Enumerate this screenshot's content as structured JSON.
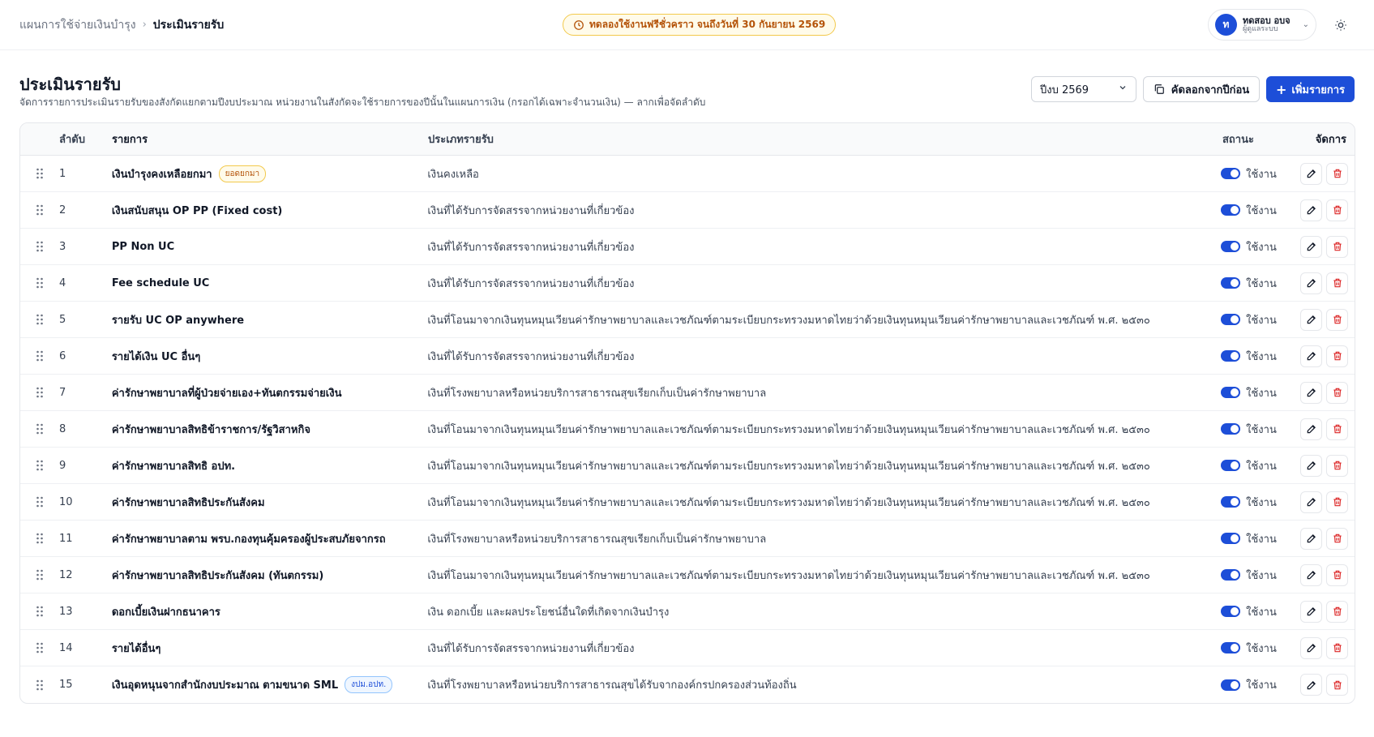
{
  "breadcrumb": {
    "parent": "แผนการใช้จ่ายเงินบำรุง",
    "current": "ประเมินรายรับ"
  },
  "trial": {
    "text": "ทดลองใช้งานฟรีชั่วคราว จนถึงวันที่ 30 กันยายน 2569"
  },
  "user": {
    "initial": "ท",
    "name": "ทดสอบ อบจ",
    "role": "ผู้ดูแลระบบ"
  },
  "page": {
    "title": "ประเมินรายรับ",
    "subtitle": "จัดการรายการประเมินรายรับของสังกัดแยกตามปีงบประมาณ หน่วยงานในสังกัดจะใช้รายการของปีนั้นในแผนการเงิน (กรอกได้เฉพาะจำนวนเงิน) — ลากเพื่อจัดลำดับ"
  },
  "toolbar": {
    "year_value": "ปีงบ 2569",
    "copy_label": "คัดลอกจากปีก่อน",
    "add_label": "เพิ่มรายการ"
  },
  "table": {
    "headers": {
      "order": "ลำดับ",
      "name": "รายการ",
      "type": "ประเภทรายรับ",
      "status": "สถานะ",
      "actions": "จัดการ"
    },
    "rows": [
      {
        "order": "1",
        "name": "เงินบำรุงคงเหลือยกมา",
        "tag": "ยอดยกมา",
        "tag_style": "amber",
        "type": "เงินคงเหลือ",
        "status": "ใช้งาน"
      },
      {
        "order": "2",
        "name": "เงินสนับสนุน OP PP (Fixed cost)",
        "tag": "",
        "tag_style": "",
        "type": "เงินที่ได้รับการจัดสรรจากหน่วยงานที่เกี่ยวข้อง",
        "status": "ใช้งาน"
      },
      {
        "order": "3",
        "name": "PP Non UC",
        "tag": "",
        "tag_style": "",
        "type": "เงินที่ได้รับการจัดสรรจากหน่วยงานที่เกี่ยวข้อง",
        "status": "ใช้งาน"
      },
      {
        "order": "4",
        "name": "Fee schedule UC",
        "tag": "",
        "tag_style": "",
        "type": "เงินที่ได้รับการจัดสรรจากหน่วยงานที่เกี่ยวข้อง",
        "status": "ใช้งาน"
      },
      {
        "order": "5",
        "name": "รายรับ UC OP anywhere",
        "tag": "",
        "tag_style": "",
        "type": "เงินที่โอนมาจากเงินทุนหมุนเวียนค่ารักษาพยาบาลและเวชภัณฑ์ตามระเบียบกระทรวงมหาดไทยว่าด้วยเงินทุนหมุนเวียนค่ารักษาพยาบาลและเวชภัณฑ์ พ.ศ. ๒๕๓๐",
        "status": "ใช้งาน"
      },
      {
        "order": "6",
        "name": "รายได้เงิน UC อื่นๆ",
        "tag": "",
        "tag_style": "",
        "type": "เงินที่ได้รับการจัดสรรจากหน่วยงานที่เกี่ยวข้อง",
        "status": "ใช้งาน"
      },
      {
        "order": "7",
        "name": "ค่ารักษาพยาบาลที่ผู้ป่วยจ่ายเอง+ทันตกรรมจ่ายเงิน",
        "tag": "",
        "tag_style": "",
        "type": "เงินที่โรงพยาบาลหรือหน่วยบริการสาธารณสุขเรียกเก็บเป็นค่ารักษาพยาบาล",
        "status": "ใช้งาน"
      },
      {
        "order": "8",
        "name": "ค่ารักษาพยาบาลสิทธิข้าราชการ/รัฐวิสาหกิจ",
        "tag": "",
        "tag_style": "",
        "type": "เงินที่โอนมาจากเงินทุนหมุนเวียนค่ารักษาพยาบาลและเวชภัณฑ์ตามระเบียบกระทรวงมหาดไทยว่าด้วยเงินทุนหมุนเวียนค่ารักษาพยาบาลและเวชภัณฑ์ พ.ศ. ๒๕๓๐",
        "status": "ใช้งาน"
      },
      {
        "order": "9",
        "name": "ค่ารักษาพยาบาลสิทธิ อปท.",
        "tag": "",
        "tag_style": "",
        "type": "เงินที่โอนมาจากเงินทุนหมุนเวียนค่ารักษาพยาบาลและเวชภัณฑ์ตามระเบียบกระทรวงมหาดไทยว่าด้วยเงินทุนหมุนเวียนค่ารักษาพยาบาลและเวชภัณฑ์ พ.ศ. ๒๕๓๐",
        "status": "ใช้งาน"
      },
      {
        "order": "10",
        "name": "ค่ารักษาพยาบาลสิทธิประกันสังคม",
        "tag": "",
        "tag_style": "",
        "type": "เงินที่โอนมาจากเงินทุนหมุนเวียนค่ารักษาพยาบาลและเวชภัณฑ์ตามระเบียบกระทรวงมหาดไทยว่าด้วยเงินทุนหมุนเวียนค่ารักษาพยาบาลและเวชภัณฑ์ พ.ศ. ๒๕๓๐",
        "status": "ใช้งาน"
      },
      {
        "order": "11",
        "name": "ค่ารักษาพยาบาลตาม พรบ.กองทุนคุ้มครองผู้ประสบภัยจากรถ",
        "tag": "",
        "tag_style": "",
        "type": "เงินที่โรงพยาบาลหรือหน่วยบริการสาธารณสุขเรียกเก็บเป็นค่ารักษาพยาบาล",
        "status": "ใช้งาน"
      },
      {
        "order": "12",
        "name": "ค่ารักษาพยาบาลสิทธิประกันสังคม (ทันตกรรม)",
        "tag": "",
        "tag_style": "",
        "type": "เงินที่โอนมาจากเงินทุนหมุนเวียนค่ารักษาพยาบาลและเวชภัณฑ์ตามระเบียบกระทรวงมหาดไทยว่าด้วยเงินทุนหมุนเวียนค่ารักษาพยาบาลและเวชภัณฑ์ พ.ศ. ๒๕๓๐",
        "status": "ใช้งาน"
      },
      {
        "order": "13",
        "name": "ดอกเบี้ยเงินฝากธนาคาร",
        "tag": "",
        "tag_style": "",
        "type": "เงิน ดอกเบี้ย และผลประโยชน์อื่นใดที่เกิดจากเงินบำรุง",
        "status": "ใช้งาน"
      },
      {
        "order": "14",
        "name": "รายได้อื่นๆ",
        "tag": "",
        "tag_style": "",
        "type": "เงินที่ได้รับการจัดสรรจากหน่วยงานที่เกี่ยวข้อง",
        "status": "ใช้งาน"
      },
      {
        "order": "15",
        "name": "เงินอุดหนุนจากสำนักงบประมาณ ตามขนาด SML",
        "tag": "งปม.อปท.",
        "tag_style": "blue",
        "type": "เงินที่โรงพยาบาลหรือหน่วยบริการสาธารณสุขได้รับจากองค์กรปกครองส่วนท้องถิ่น",
        "status": "ใช้งาน"
      }
    ]
  },
  "colors": {
    "primary": "#1d4ed8",
    "danger": "#dc2626",
    "amber": "#b45309"
  }
}
